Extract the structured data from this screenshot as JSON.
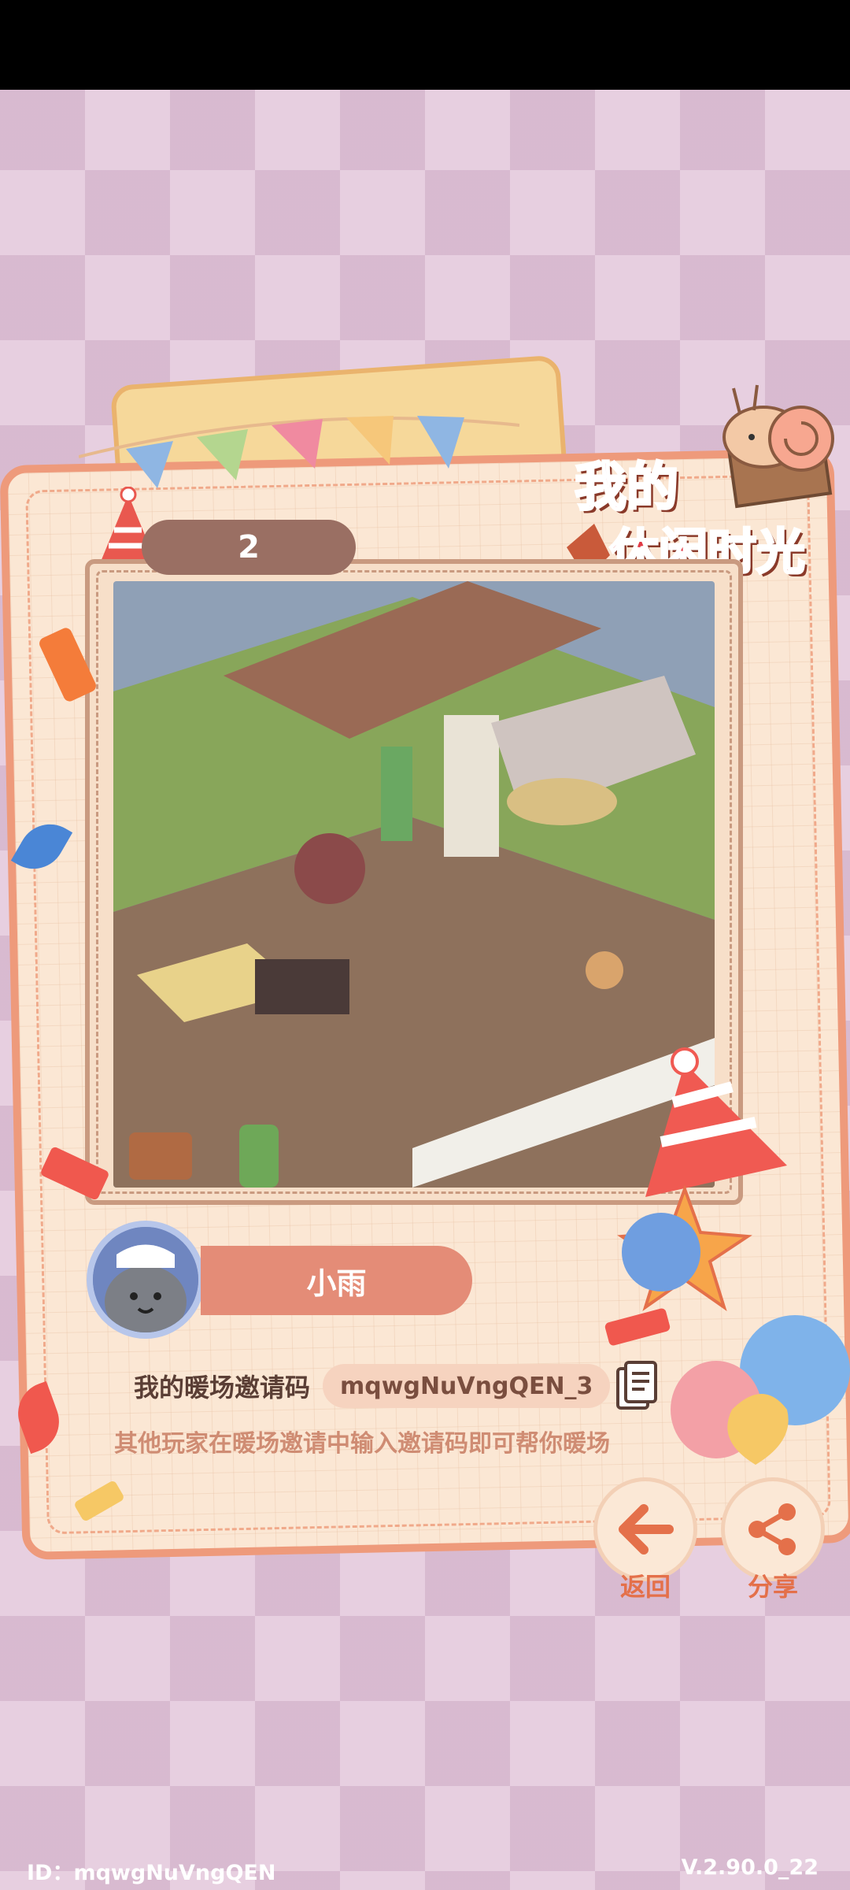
{
  "status_bar": {},
  "logo": {
    "line1": "我的",
    "line2": "休闲时光"
  },
  "photo": {
    "rank": "2"
  },
  "player": {
    "name": "小雨"
  },
  "invite": {
    "label": "我的暖场邀请码",
    "code": "mqwgNuVngQEN_3",
    "hint": "其他玩家在暖场邀请中输入邀请码即可帮你暖场"
  },
  "actions": {
    "back_label": "返回",
    "share_label": "分享"
  },
  "footer": {
    "id_text": "ID：mqwgNuVngQEN",
    "version": "V.2.90.0_22"
  },
  "colors": {
    "accent": "#e4704a",
    "frame": "#ee9a7b",
    "avatar_bg": "#6f86c0",
    "name_pill": "#e48c77"
  },
  "icons": [
    "party-hat-icon",
    "copy-icon",
    "back-arrow-icon",
    "share-icon"
  ]
}
